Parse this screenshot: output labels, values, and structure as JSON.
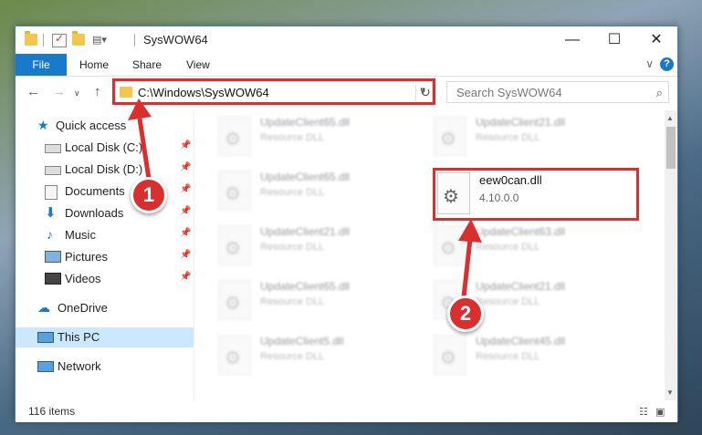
{
  "window": {
    "title": "SysWOW64"
  },
  "titlebar": {
    "minimize": "—",
    "maximize": "☐",
    "close": "✕"
  },
  "ribbon": {
    "tabs": [
      "File",
      "Home",
      "Share",
      "View"
    ],
    "help": "?",
    "collapse": "∨"
  },
  "address": {
    "path": "C:\\Windows\\SysWOW64"
  },
  "search": {
    "placeholder": "Search SysWOW64"
  },
  "nav": [
    {
      "label": "Quick access",
      "icon": "star-icon",
      "pinned": false
    },
    {
      "label": "Local Disk (C:)",
      "icon": "drive-icon",
      "pinned": true
    },
    {
      "label": "Local Disk (D:)",
      "icon": "drive-icon",
      "pinned": true
    },
    {
      "label": "Documents",
      "icon": "documents-icon",
      "pinned": true
    },
    {
      "label": "Downloads",
      "icon": "download-icon",
      "pinned": true
    },
    {
      "label": "Music",
      "icon": "music-icon",
      "pinned": true
    },
    {
      "label": "Pictures",
      "icon": "pictures-icon",
      "pinned": true
    },
    {
      "label": "Videos",
      "icon": "videos-icon",
      "pinned": true
    },
    {
      "label": "OneDrive",
      "icon": "cloud-icon",
      "pinned": false
    },
    {
      "label": "This PC",
      "icon": "computer-icon",
      "pinned": false,
      "selected": true
    },
    {
      "label": "Network",
      "icon": "network-icon",
      "pinned": false
    }
  ],
  "files": {
    "left": [
      {
        "name": "UpdateClient65.dll",
        "desc": "Resource DLL"
      },
      {
        "name": "UpdateClient65.dll",
        "desc": "Resource DLL"
      },
      {
        "name": "UpdateClient21.dll",
        "desc": "Resource DLL"
      },
      {
        "name": "UpdateClient65.dll",
        "desc": "Resource DLL"
      },
      {
        "name": "UpdateClient5.dll",
        "desc": "Resource DLL"
      }
    ],
    "right": [
      {
        "name": "UpdateClient21.dll",
        "desc": "Resource DLL"
      },
      {
        "name": "UpdateClient63.dll",
        "desc": "Resource DLL"
      },
      {
        "name": "UpdateClient21.dll",
        "desc": "Resource DLL"
      },
      {
        "name": "UpdateClient45.dll",
        "desc": "Resource DLL"
      }
    ],
    "target": {
      "name": "eew0can.dll",
      "version": "4.10.0.0"
    }
  },
  "status": {
    "count": "116 items"
  },
  "annotations": {
    "step1": "1",
    "step2": "2"
  },
  "colors": {
    "accent": "#1979ca",
    "highlight": "#d9302f",
    "selected": "#cce8ff"
  }
}
